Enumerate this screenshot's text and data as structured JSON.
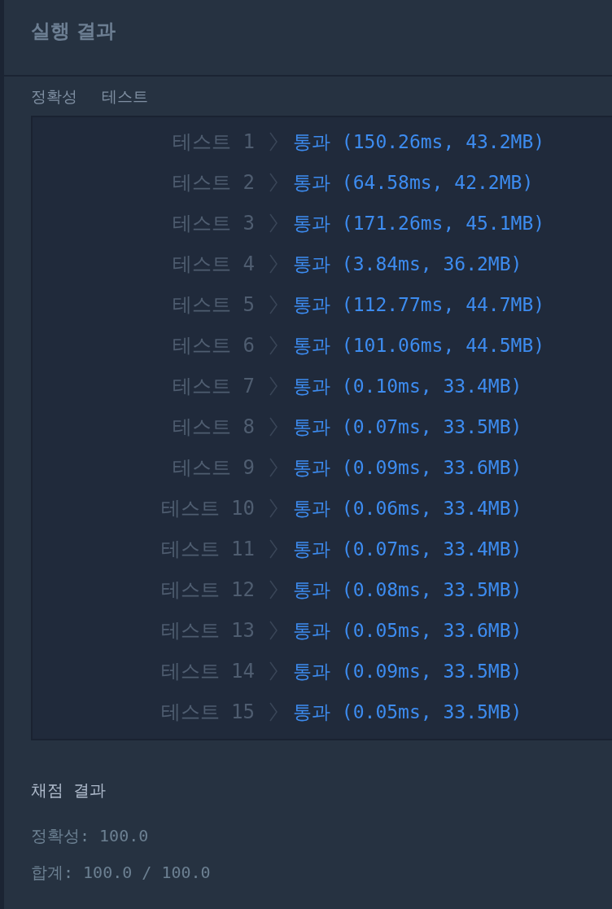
{
  "title": "실행 결과",
  "section": {
    "category": "정확성",
    "name": "테스트"
  },
  "tests": [
    {
      "label": "테스트 1",
      "result": "통과 (150.26ms, 43.2MB)"
    },
    {
      "label": "테스트 2",
      "result": "통과 (64.58ms, 42.2MB)"
    },
    {
      "label": "테스트 3",
      "result": "통과 (171.26ms, 45.1MB)"
    },
    {
      "label": "테스트 4",
      "result": "통과 (3.84ms, 36.2MB)"
    },
    {
      "label": "테스트 5",
      "result": "통과 (112.77ms, 44.7MB)"
    },
    {
      "label": "테스트 6",
      "result": "통과 (101.06ms, 44.5MB)"
    },
    {
      "label": "테스트 7",
      "result": "통과 (0.10ms, 33.4MB)"
    },
    {
      "label": "테스트 8",
      "result": "통과 (0.07ms, 33.5MB)"
    },
    {
      "label": "테스트 9",
      "result": "통과 (0.09ms, 33.6MB)"
    },
    {
      "label": "테스트 10",
      "result": "통과 (0.06ms, 33.4MB)"
    },
    {
      "label": "테스트 11",
      "result": "통과 (0.07ms, 33.4MB)"
    },
    {
      "label": "테스트 12",
      "result": "통과 (0.08ms, 33.5MB)"
    },
    {
      "label": "테스트 13",
      "result": "통과 (0.05ms, 33.6MB)"
    },
    {
      "label": "테스트 14",
      "result": "통과 (0.09ms, 33.5MB)"
    },
    {
      "label": "테스트 15",
      "result": "통과 (0.05ms, 33.5MB)"
    }
  ],
  "grading": {
    "title": "채점 결과",
    "lines": [
      "정확성: 100.0",
      "합계: 100.0 / 100.0"
    ]
  }
}
